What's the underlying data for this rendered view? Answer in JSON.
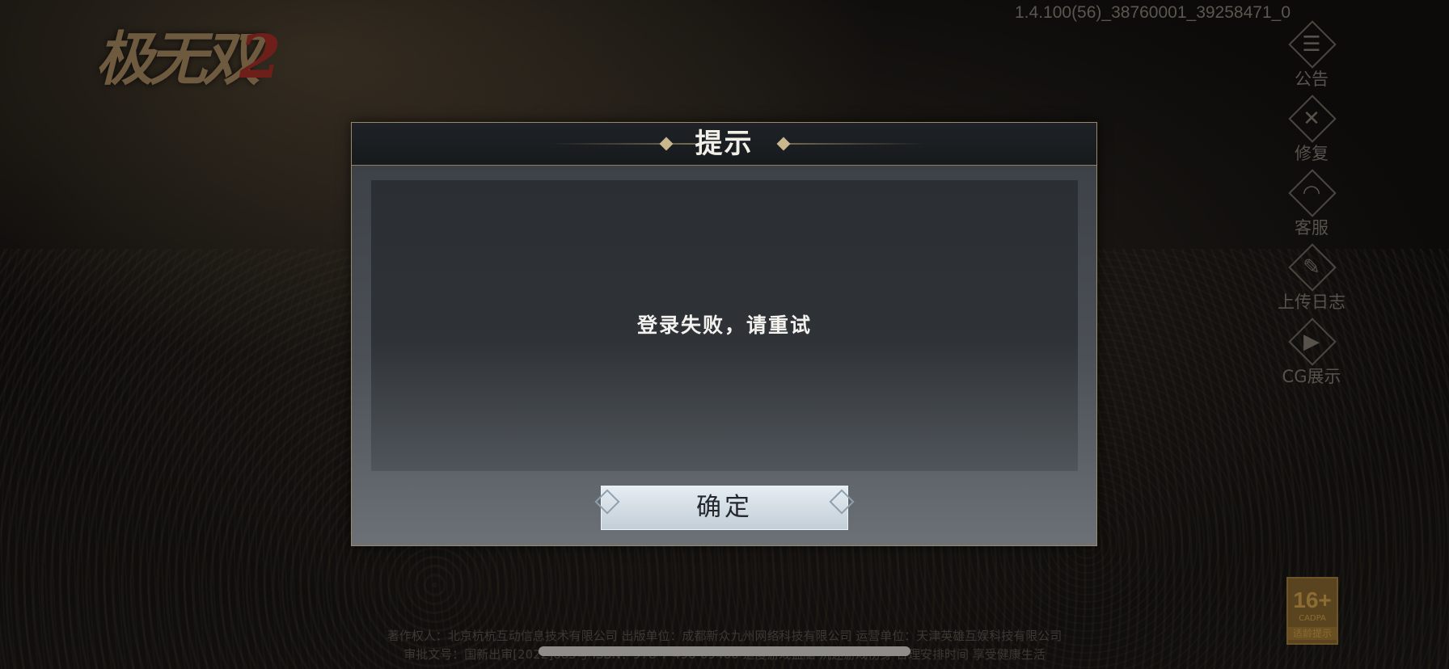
{
  "game": {
    "logo_text": "极无双",
    "logo_number": "2"
  },
  "version": "1.4.100(56)_38760001_39258471_0",
  "side_menu": [
    {
      "label": "公告",
      "icon": "notice-icon",
      "glyph": "☰"
    },
    {
      "label": "修复",
      "icon": "repair-icon",
      "glyph": "✕"
    },
    {
      "label": "客服",
      "icon": "headset-icon",
      "glyph": "◠"
    },
    {
      "label": "上传日志",
      "icon": "upload-log-icon",
      "glyph": "✎"
    },
    {
      "label": "CG展示",
      "icon": "video-icon",
      "glyph": "▶"
    }
  ],
  "dialog": {
    "title": "提示",
    "message": "登录失败，请重试",
    "confirm_label": "确定"
  },
  "age_rating": {
    "value": "16+",
    "org": "CADPA",
    "tip": "适龄提示"
  },
  "footer": {
    "line1": "著作权人：北京杭杭互动信息技术有限公司 出版单位：成都新众九州网络科技有限公司 运营单位：天津英雄互娱科技有限公司",
    "line2": "审批文号：国新出审[2022]683号 ISBN：978-7-498-09400 适度游戏益脑 沉迷游戏伤身 合理安排时间 享受健康生活"
  },
  "colors": {
    "dialog_border": "#9a8b66",
    "button_bg": "#dbe3ea",
    "title_text": "#f2efe8"
  }
}
